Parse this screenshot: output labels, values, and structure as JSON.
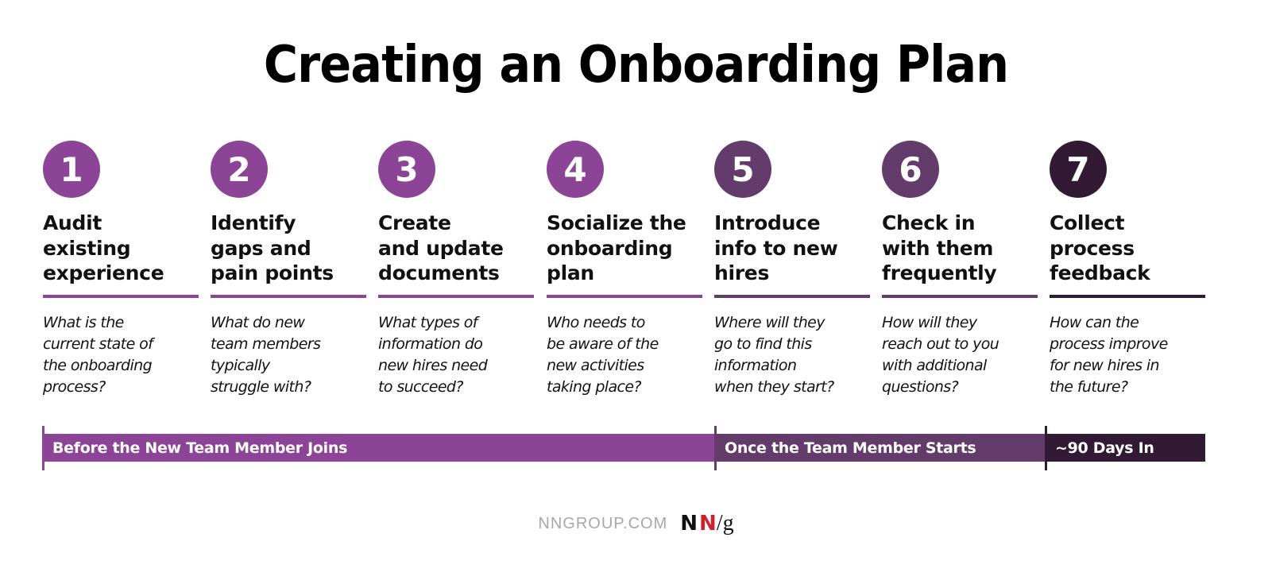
{
  "title": "Creating an Onboarding Plan",
  "colors": {
    "purple": "#8c4596",
    "plum": "#643c6b",
    "dark": "#321a35",
    "text": "#111111",
    "footer_gray": "#a6a6ad",
    "logo_red": "#d0202e"
  },
  "steps": [
    {
      "number": "1",
      "heading": "Audit\nexisting\nexperience",
      "question": "What is the\ncurrent state of\nthe onboarding\nprocess?",
      "color": "#8c4596"
    },
    {
      "number": "2",
      "heading": "Identify\ngaps and\npain points",
      "question": "What do new\nteam members\ntypically\nstruggle with?",
      "color": "#8c4596"
    },
    {
      "number": "3",
      "heading": "Create\nand update\ndocuments",
      "question": "What types of\ninformation do\nnew hires need\nto succeed?",
      "color": "#8c4596"
    },
    {
      "number": "4",
      "heading": "Socialize the\nonboarding\nplan",
      "question": "Who needs to\nbe aware of the\nnew activities\ntaking place?",
      "color": "#8c4596"
    },
    {
      "number": "5",
      "heading": "Introduce\ninfo to new\nhires",
      "question": "Where will they\ngo to find this\ninformation\nwhen they start?",
      "color": "#643c6b"
    },
    {
      "number": "6",
      "heading": "Check in\nwith them\nfrequently",
      "question": "How will they\nreach out to you\nwith additional\nquestions?",
      "color": "#643c6b"
    },
    {
      "number": "7",
      "heading": "Collect\nprocess\nfeedback",
      "question": "How can the\nprocess improve\nfor new hires in\nthe future?",
      "color": "#321a35"
    }
  ],
  "phases": [
    {
      "label": "Before the New Team Member Joins",
      "color": "#8c4596",
      "steps": "1-4"
    },
    {
      "label": "Once the Team Member Starts",
      "color": "#643c6b",
      "steps": "5-6"
    },
    {
      "label": "~90 Days In",
      "color": "#321a35",
      "steps": "7"
    }
  ],
  "footer": {
    "site": "NNGROUP.COM",
    "logo_n1": "N",
    "logo_n2": "N",
    "logo_slash_g": "/g"
  }
}
